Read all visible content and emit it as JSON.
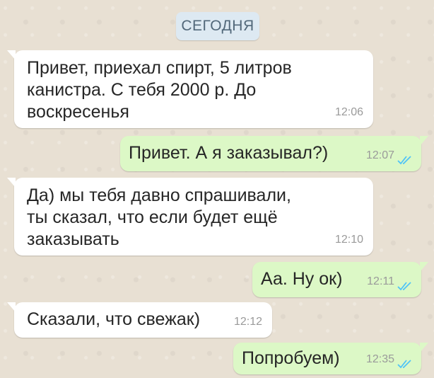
{
  "date_label": "СЕГОДНЯ",
  "messages": [
    {
      "direction": "incoming",
      "text": "Привет, приехал спирт, 5 литров\nканистра. С тебя 2000 р. До\nвоскресенья",
      "time": "12:06"
    },
    {
      "direction": "outgoing",
      "text": "Привет. А я заказывал?)",
      "time": "12:07",
      "status": "read"
    },
    {
      "direction": "incoming",
      "text": "Да) мы тебя давно спрашивали,\nты сказал, что если будет ещё\nзаказывать",
      "time": "12:10"
    },
    {
      "direction": "outgoing",
      "text": "Аа. Ну ок)",
      "time": "12:11",
      "status": "read"
    },
    {
      "direction": "incoming",
      "text": "Сказали, что свежак)",
      "time": "12:12"
    },
    {
      "direction": "outgoing",
      "text": "Попробуем)",
      "time": "12:35",
      "status": "read"
    }
  ],
  "colors": {
    "incoming_bubble": "#ffffff",
    "outgoing_bubble": "#dcf8c6",
    "read_ticks": "#4fc3f7"
  }
}
